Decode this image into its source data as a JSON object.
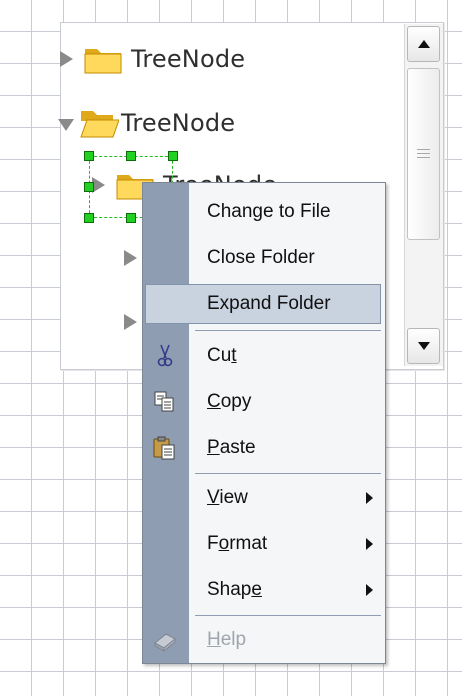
{
  "tree": {
    "nodes": [
      {
        "label": "TreeNode",
        "expanded": false
      },
      {
        "label": "TreeNode",
        "expanded": true
      },
      {
        "label": "TreeNode",
        "expanded": false
      }
    ]
  },
  "context_menu": {
    "items": [
      {
        "label": "Change to File",
        "icon": "",
        "enabled": true
      },
      {
        "label": "Close Folder",
        "icon": "",
        "enabled": true
      },
      {
        "label": "Expand Folder",
        "icon": "",
        "enabled": true,
        "highlighted": true
      },
      {
        "label": "Cut",
        "icon": "scissors-icon",
        "enabled": true,
        "mnemonic": "t"
      },
      {
        "label": "Copy",
        "icon": "copy-icon",
        "enabled": true,
        "mnemonic": "C"
      },
      {
        "label": "Paste",
        "icon": "paste-icon",
        "enabled": true,
        "mnemonic": "P"
      },
      {
        "label": "View",
        "icon": "",
        "enabled": true,
        "submenu": true,
        "mnemonic": "V"
      },
      {
        "label": "Format",
        "icon": "",
        "enabled": true,
        "submenu": true,
        "mnemonic": "o"
      },
      {
        "label": "Shape",
        "icon": "",
        "enabled": true,
        "submenu": true,
        "mnemonic": "e"
      },
      {
        "label": "Help",
        "icon": "help-book-icon",
        "enabled": false,
        "mnemonic": "H"
      }
    ]
  },
  "colors": {
    "selection": "#22d022",
    "menu_gutter": "#8e9db2",
    "menu_highlight": "#c9d3df"
  }
}
